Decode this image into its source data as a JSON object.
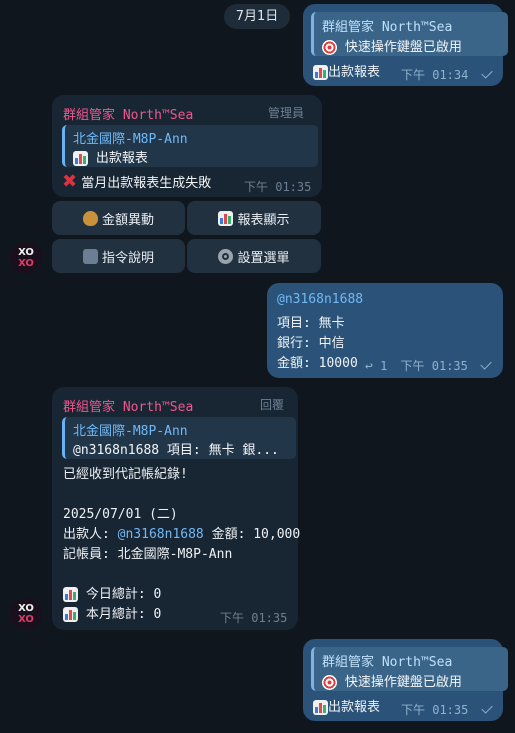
{
  "date_pill": "7月1日",
  "msg1": {
    "quote_name": "群組管家 North™Sea",
    "quote_text": "快速操作鍵盤已啟用",
    "text": "出款報表",
    "time": "下午 01:34"
  },
  "msg2": {
    "sender": "群組管家 North™Sea",
    "role": "管理員",
    "quote_name": "北金國際-M8P-Ann",
    "quote_text": "出款報表",
    "text": "當月出款報表生成失敗",
    "time": "下午 01:35",
    "buttons": [
      "金額異動",
      "報表顯示",
      "指令說明",
      "設置選單"
    ]
  },
  "msg3": {
    "mention": "@n3168n1688",
    "line_item": "項目: 無卡",
    "line_bank": "銀行: 中信",
    "line_amount": "金額: 10000",
    "reply_count": "1",
    "time": "下午 01:35"
  },
  "msg4": {
    "sender": "群組管家 North™Sea",
    "role": "回覆",
    "quote_name": "北金國際-M8P-Ann",
    "quote_text": "@n3168n1688 項目: 無卡 銀...",
    "line1": "已經收到代記帳紀錄!",
    "line2": "2025/07/01 (二)",
    "payer_label": "出款人:",
    "payer_mention": "@n3168n1688",
    "amount_text": "金額: 10,000",
    "bookkeeper": "記帳員: 北金國際-M8P-Ann",
    "today_total": "今日總計: 0",
    "month_total": "本月總計: 0",
    "time": "下午 01:35"
  },
  "msg5": {
    "quote_name": "群組管家 North™Sea",
    "quote_text": "快速操作鍵盤已啟用",
    "text": "出款報表",
    "time": "下午 01:35"
  },
  "avatar_text": [
    "XO",
    "XO"
  ],
  "colors": {
    "background": "#0f161e",
    "outgoing_bubble": "#2b5278",
    "incoming_bubble": "#182533",
    "sender_name": "#f0578f",
    "mention": "#71b9f5"
  },
  "icons": [
    "bar-chart-icon",
    "dart-icon",
    "cross-mark-icon",
    "money-bag-icon",
    "keys-icon",
    "gear-icon",
    "reply-icon",
    "check-icon"
  ]
}
